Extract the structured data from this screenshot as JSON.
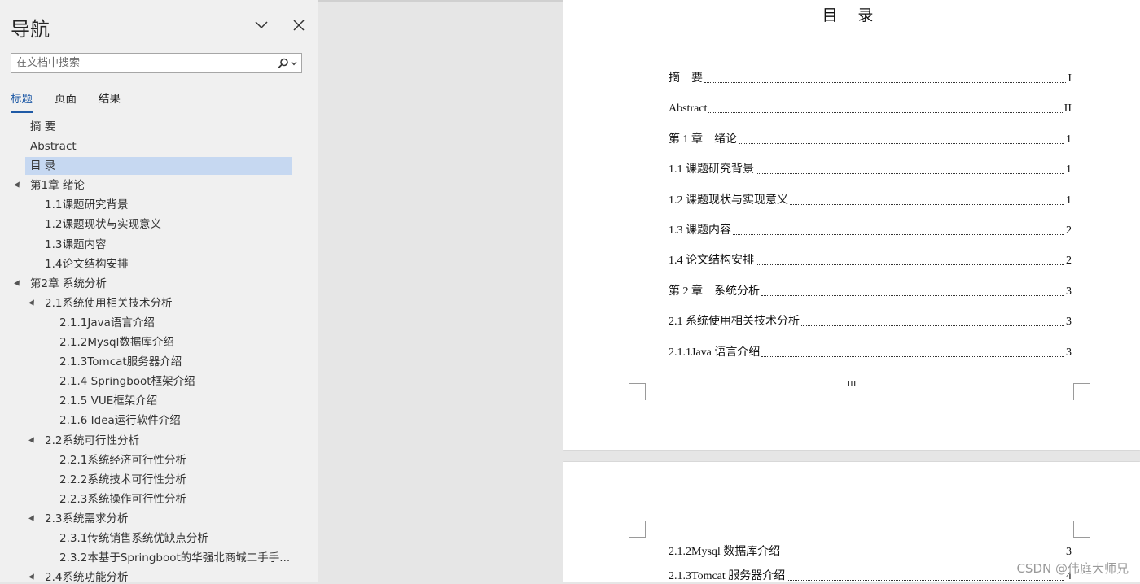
{
  "nav": {
    "title": "导航",
    "search_placeholder": "在文档中搜索",
    "tabs": [
      {
        "label": "标题",
        "active": true
      },
      {
        "label": "页面",
        "active": false
      },
      {
        "label": "结果",
        "active": false
      }
    ],
    "headings": [
      {
        "label": "摘  要",
        "level": 1,
        "arrow": false
      },
      {
        "label": "Abstract",
        "level": 1,
        "arrow": false
      },
      {
        "label": "目 录",
        "level": 1,
        "arrow": false,
        "selected": true
      },
      {
        "label": "第1章 绪论",
        "level": 1,
        "arrow": true
      },
      {
        "label": "1.1课题研究背景",
        "level": 2,
        "arrow": false
      },
      {
        "label": "1.2课题现状与实现意义",
        "level": 2,
        "arrow": false
      },
      {
        "label": "1.3课题内容",
        "level": 2,
        "arrow": false
      },
      {
        "label": "1.4论文结构安排",
        "level": 2,
        "arrow": false
      },
      {
        "label": "第2章 系统分析",
        "level": 1,
        "arrow": true
      },
      {
        "label": "2.1系统使用相关技术分析",
        "level": 2,
        "arrow": true
      },
      {
        "label": "2.1.1Java语言介绍",
        "level": 3,
        "arrow": false
      },
      {
        "label": "2.1.2Mysql数据库介绍",
        "level": 3,
        "arrow": false
      },
      {
        "label": "2.1.3Tomcat服务器介绍",
        "level": 3,
        "arrow": false
      },
      {
        "label": "2.1.4 Springboot框架介绍",
        "level": 3,
        "arrow": false
      },
      {
        "label": "2.1.5 VUE框架介绍",
        "level": 3,
        "arrow": false
      },
      {
        "label": "2.1.6 Idea运行软件介绍",
        "level": 3,
        "arrow": false
      },
      {
        "label": "2.2系统可行性分析",
        "level": 2,
        "arrow": true
      },
      {
        "label": "2.2.1系统经济可行性分析",
        "level": 3,
        "arrow": false
      },
      {
        "label": "2.2.2系统技术可行性分析",
        "level": 3,
        "arrow": false
      },
      {
        "label": "2.2.3系统操作可行性分析",
        "level": 3,
        "arrow": false
      },
      {
        "label": "2.3系统需求分析",
        "level": 2,
        "arrow": true
      },
      {
        "label": "2.3.1传统销售系统优缺点分析",
        "level": 3,
        "arrow": false
      },
      {
        "label": "2.3.2本基于Springboot的华强北商城二手手...",
        "level": 3,
        "arrow": false
      },
      {
        "label": "2.4系统功能分析",
        "level": 2,
        "arrow": true
      }
    ]
  },
  "document": {
    "toc_title": "目 录",
    "toc_entries": [
      {
        "text": "摘    要",
        "page": "I"
      },
      {
        "text": "Abstract",
        "page": "II"
      },
      {
        "text": "第 1 章    绪论",
        "page": "1"
      },
      {
        "text": "1.1 课题研究背景",
        "page": "1"
      },
      {
        "text": "1.2 课题现状与实现意义",
        "page": "1"
      },
      {
        "text": "1.3 课题内容",
        "page": "2"
      },
      {
        "text": "1.4 论文结构安排",
        "page": "2"
      },
      {
        "text": "第 2 章    系统分析",
        "page": "3"
      },
      {
        "text": "2.1 系统使用相关技术分析",
        "page": "3"
      },
      {
        "text": "2.1.1Java 语言介绍",
        "page": "3"
      }
    ],
    "page_number": "III",
    "page2_entries": [
      {
        "text": "2.1.2Mysql 数据库介绍",
        "page": "3"
      },
      {
        "text": "2.1.3Tomcat 服务器介绍",
        "page": "4"
      }
    ]
  },
  "watermark": "CSDN @伟庭大师兄"
}
